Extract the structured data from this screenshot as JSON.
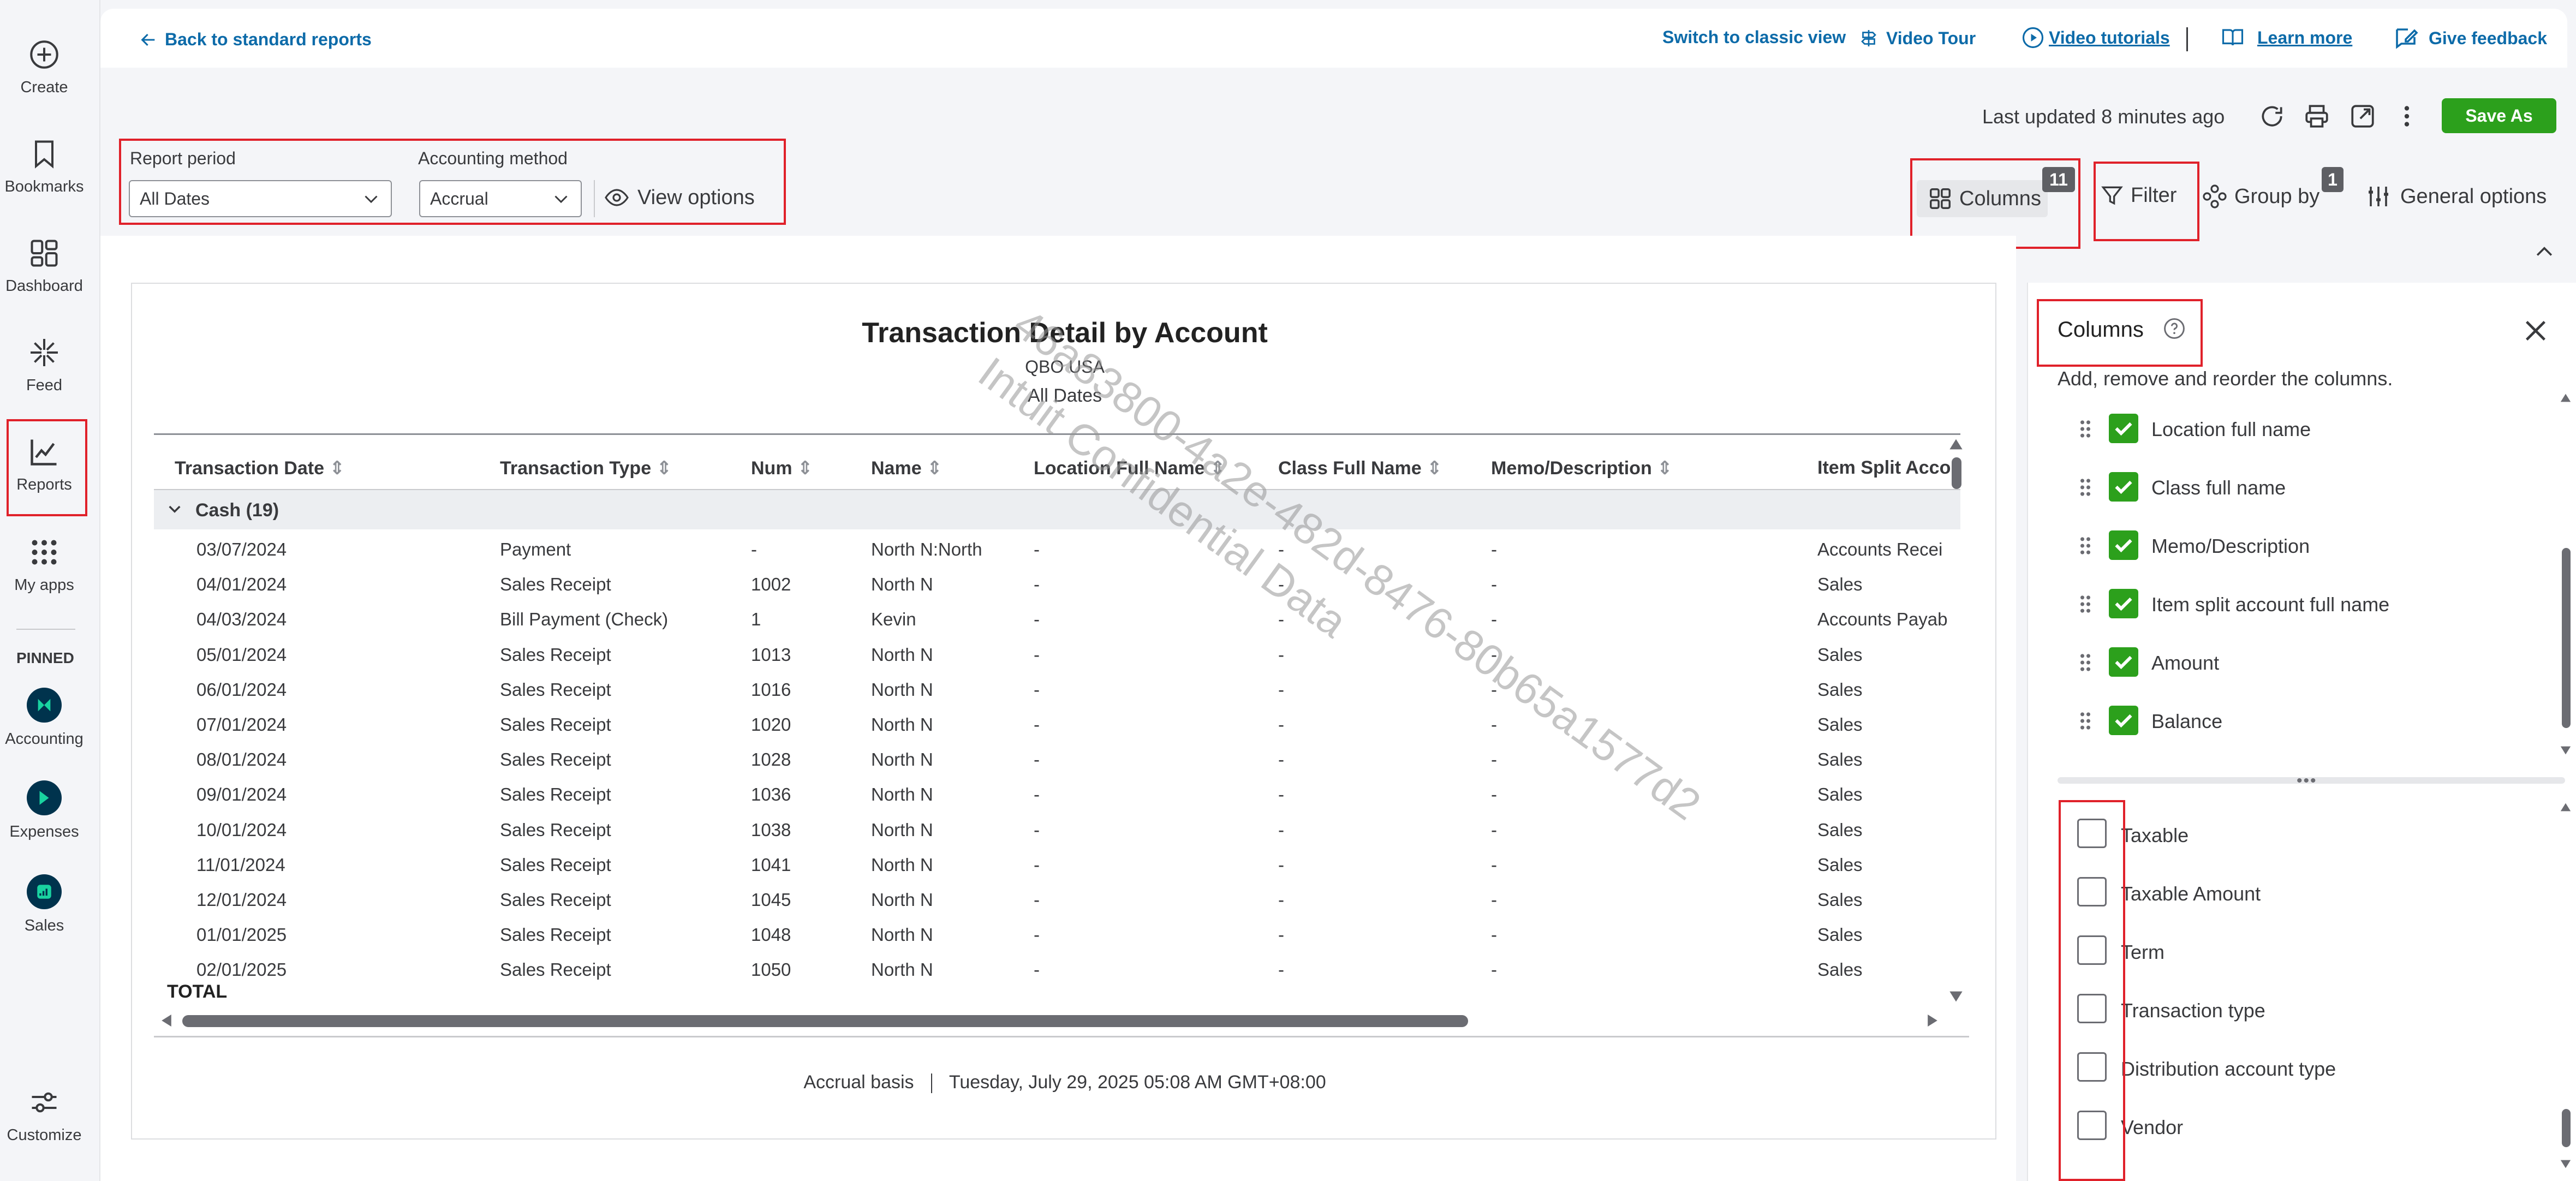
{
  "nav": {
    "items": [
      {
        "label": "Create",
        "icon": "plus-circle-icon"
      },
      {
        "label": "Bookmarks",
        "icon": "bookmark-icon"
      },
      {
        "label": "Dashboard",
        "icon": "dashboard-grid-icon"
      },
      {
        "label": "Feed",
        "icon": "sparkle-icon"
      },
      {
        "label": "Reports",
        "icon": "line-chart-icon"
      },
      {
        "label": "My apps",
        "icon": "apps-grid-icon"
      }
    ],
    "pinned_label": "PINNED",
    "pinned": [
      {
        "label": "Accounting",
        "icon": "accounting-icon"
      },
      {
        "label": "Expenses",
        "icon": "expenses-icon"
      },
      {
        "label": "Sales",
        "icon": "sales-icon"
      }
    ],
    "customize_label": "Customize"
  },
  "header": {
    "back_link": "Back to standard reports",
    "switch_classic": "Switch to classic view",
    "video_tour": "Video Tour",
    "video_tutorials": "Video tutorials",
    "learn_more": "Learn more",
    "give_feedback": "Give feedback"
  },
  "toolbar": {
    "last_updated": "Last updated 8 minutes ago",
    "save_as": "Save As",
    "report_period_label": "Report period",
    "report_period_value": "All Dates",
    "accounting_method_label": "Accounting method",
    "accounting_method_value": "Accrual",
    "view_options": "View options",
    "columns": "Columns",
    "columns_badge": "11",
    "filter": "Filter",
    "group_by": "Group by",
    "group_by_badge": "1",
    "general_options": "General options"
  },
  "report": {
    "title": "Transaction Detail by Account",
    "company": "QBO USA",
    "period": "All Dates",
    "columns": [
      "Transaction Date",
      "Transaction Type",
      "Num",
      "Name",
      "Location Full Name",
      "Class Full Name",
      "Memo/Description",
      "Item Split Acco"
    ],
    "group_label": "Cash (19)",
    "rows": [
      [
        "03/07/2024",
        "Payment",
        "-",
        "North N:North",
        "-",
        "-",
        "-",
        "Accounts Recei"
      ],
      [
        "04/01/2024",
        "Sales Receipt",
        "1002",
        "North N",
        "-",
        "-",
        "-",
        "Sales"
      ],
      [
        "04/03/2024",
        "Bill Payment (Check)",
        "1",
        "Kevin",
        "-",
        "-",
        "-",
        "Accounts Payab"
      ],
      [
        "05/01/2024",
        "Sales Receipt",
        "1013",
        "North N",
        "-",
        "-",
        "-",
        "Sales"
      ],
      [
        "06/01/2024",
        "Sales Receipt",
        "1016",
        "North N",
        "-",
        "-",
        "-",
        "Sales"
      ],
      [
        "07/01/2024",
        "Sales Receipt",
        "1020",
        "North N",
        "-",
        "-",
        "-",
        "Sales"
      ],
      [
        "08/01/2024",
        "Sales Receipt",
        "1028",
        "North N",
        "-",
        "-",
        "-",
        "Sales"
      ],
      [
        "09/01/2024",
        "Sales Receipt",
        "1036",
        "North N",
        "-",
        "-",
        "-",
        "Sales"
      ],
      [
        "10/01/2024",
        "Sales Receipt",
        "1038",
        "North N",
        "-",
        "-",
        "-",
        "Sales"
      ],
      [
        "11/01/2024",
        "Sales Receipt",
        "1041",
        "North N",
        "-",
        "-",
        "-",
        "Sales"
      ],
      [
        "12/01/2024",
        "Sales Receipt",
        "1045",
        "North N",
        "-",
        "-",
        "-",
        "Sales"
      ],
      [
        "01/01/2025",
        "Sales Receipt",
        "1048",
        "North N",
        "-",
        "-",
        "-",
        "Sales"
      ],
      [
        "02/01/2025",
        "Sales Receipt",
        "1050",
        "North N",
        "-",
        "-",
        "-",
        "Sales"
      ]
    ],
    "total_label": "TOTAL",
    "footer_basis": "Accrual basis",
    "footer_date": "Tuesday, July 29, 2025 05:08 AM GMT+08:00"
  },
  "watermark": {
    "line1": "46a83800-4a2e-482d-8476-80b65a1577d2",
    "line2": "Intuit Confidential Data"
  },
  "columns_panel": {
    "title": "Columns",
    "subtitle": "Add, remove and reorder the columns.",
    "selected": [
      "Location full name",
      "Class full name",
      "Memo/Description",
      "Item split account full name",
      "Amount",
      "Balance"
    ],
    "available": [
      "Taxable",
      "Taxable Amount",
      "Term",
      "Transaction type",
      "Distribution account type",
      "Vendor"
    ]
  },
  "colors": {
    "accent_green": "#2ca01c",
    "link_blue": "#0d6ba9",
    "highlight_red": "#e0212a"
  }
}
